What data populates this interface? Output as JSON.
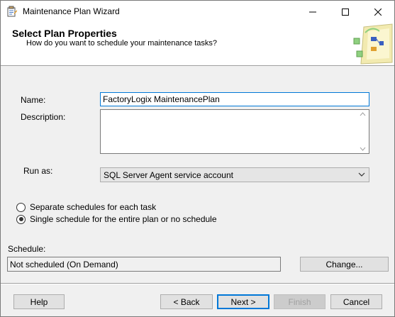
{
  "window": {
    "title": "Maintenance Plan Wizard"
  },
  "header": {
    "title": "Select Plan Properties",
    "subtitle": "How do you want to schedule your maintenance tasks?"
  },
  "form": {
    "name_label": "Name:",
    "name_value": "FactoryLogix MaintenancePlan",
    "description_label": "Description:",
    "description_value": "",
    "run_as_label": "Run as:",
    "run_as_value": "SQL Server Agent service account"
  },
  "schedule_options": [
    {
      "label": "Separate schedules for each task",
      "selected": false
    },
    {
      "label": "Single schedule for the entire plan or no schedule",
      "selected": true
    }
  ],
  "schedule": {
    "label": "Schedule:",
    "value": "Not scheduled (On Demand)",
    "change_button": "Change..."
  },
  "footer": {
    "help": "Help",
    "back": "< Back",
    "next": "Next >",
    "finish": "Finish",
    "cancel": "Cancel"
  },
  "icons": {
    "app": "wizard-app-icon",
    "minimize": "minimize-icon",
    "maximize": "maximize-icon",
    "close": "close-icon",
    "header": "wizard-header-graphic",
    "dropdown": "chevron-down-icon"
  },
  "colors": {
    "focus_border": "#0078d7",
    "window_bg": "#f0f0f0",
    "button_bg": "#e1e1e1"
  }
}
